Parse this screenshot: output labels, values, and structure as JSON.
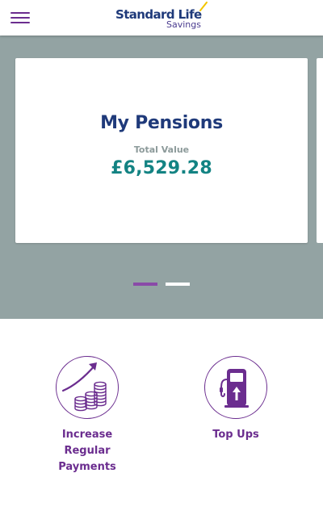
{
  "header": {
    "logo_main": "Standard Life",
    "logo_sub": "Savings",
    "menu_icon": "hamburger-menu-icon"
  },
  "carousel": {
    "card": {
      "title": "My Pensions",
      "value_label": "Total Value",
      "value": "£6,529.28"
    },
    "page_count": 2,
    "active_page": 1
  },
  "actions": [
    {
      "label": "Increase Regular Payments",
      "icon": "coins-growth-icon"
    },
    {
      "label": "Top Ups",
      "icon": "fuel-pump-icon"
    }
  ],
  "colors": {
    "brand_purple": "#6b2d8f",
    "brand_navy": "#1f3a7a",
    "value_teal": "#138383",
    "carousel_bg": "#93a3a3",
    "logo_tick": "#f2c500"
  }
}
